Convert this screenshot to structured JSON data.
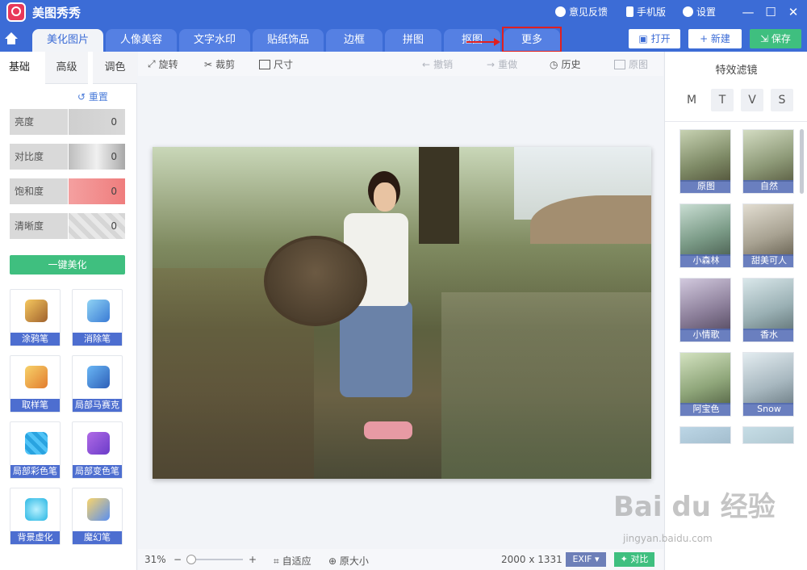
{
  "titlebar": {
    "app_title": "美图秀秀",
    "feedback": "意见反馈",
    "mobile": "手机版",
    "settings": "设置"
  },
  "tabs": [
    {
      "label": "美化图片",
      "active": true
    },
    {
      "label": "人像美容"
    },
    {
      "label": "文字水印"
    },
    {
      "label": "贴纸饰品"
    },
    {
      "label": "边框"
    },
    {
      "label": "拼图"
    },
    {
      "label": "抠图"
    },
    {
      "label": "更多",
      "highlighted": true
    }
  ],
  "header_buttons": {
    "open": "打开",
    "new": "+ 新建",
    "save": "保存"
  },
  "left_panel": {
    "tabs": [
      "基础",
      "高级",
      "调色"
    ],
    "reset": "重置",
    "sliders": [
      {
        "label": "亮度",
        "value": "0",
        "color": "#d0d0d0"
      },
      {
        "label": "对比度",
        "value": "0",
        "color": "#b5b5b5"
      },
      {
        "label": "饱和度",
        "value": "0",
        "color": "#f28b8b"
      },
      {
        "label": "清晰度",
        "value": "0",
        "color": "#e0e0e0"
      }
    ],
    "auto_beautify": "一键美化",
    "tools": [
      {
        "label": "涂鸦笔",
        "icon": "paintbrush-icon"
      },
      {
        "label": "消除笔",
        "icon": "eraser-icon"
      },
      {
        "label": "取样笔",
        "icon": "sample-brush-icon"
      },
      {
        "label": "局部马赛克",
        "icon": "mosaic-pen-icon"
      },
      {
        "label": "局部彩色笔",
        "icon": "color-pen-icon"
      },
      {
        "label": "局部变色笔",
        "icon": "recolor-pen-icon"
      },
      {
        "label": "背景虚化",
        "icon": "blur-background-icon"
      },
      {
        "label": "魔幻笔",
        "icon": "magic-wand-icon"
      }
    ]
  },
  "toolbar": {
    "rotate": "旋转",
    "crop": "裁剪",
    "size": "尺寸",
    "undo": "撤销",
    "redo": "重做",
    "history": "历史",
    "original": "原图"
  },
  "status": {
    "zoom": "31%",
    "fit": "自适应",
    "actual_size": "原大小",
    "dimensions": "2000 x 1331",
    "exif": "EXIF",
    "compare": "对比"
  },
  "right_panel": {
    "title": "特效滤镜",
    "categories": [
      "M",
      "T",
      "V",
      "S"
    ],
    "filters": [
      {
        "label": "原图",
        "tint": "#7e8a66"
      },
      {
        "label": "自然",
        "tint": "#8e9a78"
      },
      {
        "label": "小森林",
        "tint": "#7a9a86"
      },
      {
        "label": "甜美可人",
        "tint": "#a8a292"
      },
      {
        "label": "小情歌",
        "tint": "#8c7f9a"
      },
      {
        "label": "香水",
        "tint": "#9ab0b4"
      },
      {
        "label": "阿宝色",
        "tint": "#8fa67a"
      },
      {
        "label": "Snow",
        "tint": "#a8b8c0"
      }
    ]
  },
  "watermark": {
    "brand": "Bai du 经验",
    "url": "jingyan.baidu.com"
  }
}
